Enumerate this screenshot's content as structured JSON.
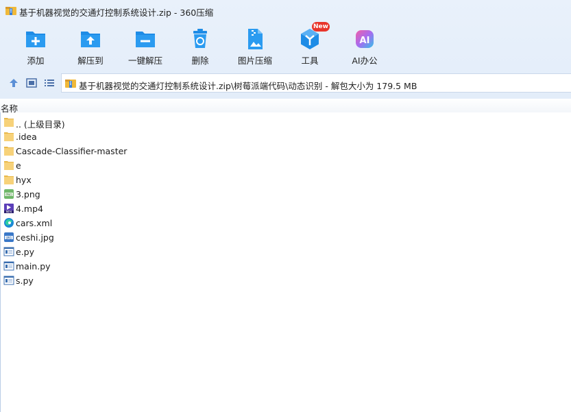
{
  "window": {
    "title": "基于机器视觉的交通灯控制系统设计.zip - 360压缩"
  },
  "toolbar": {
    "buttons": [
      {
        "label": "添加",
        "icon": "add-icon"
      },
      {
        "label": "解压到",
        "icon": "extract-to-icon"
      },
      {
        "label": "一键解压",
        "icon": "one-click-extract-icon"
      },
      {
        "label": "删除",
        "icon": "trash-icon"
      },
      {
        "label": "图片压缩",
        "icon": "image-compress-icon"
      },
      {
        "label": "工具",
        "icon": "tools-icon",
        "badge": "New"
      },
      {
        "label": "AI办公",
        "icon": "ai-office-icon"
      }
    ]
  },
  "navbar": {
    "path": "基于机器视觉的交通灯控制系统设计.zip\\树莓派端代码\\动态识别 - 解包大小为 179.5 MB"
  },
  "filelist": {
    "column_name": "名称",
    "items": [
      {
        "name": ".. (上级目录)",
        "type": "folder"
      },
      {
        "name": ".idea",
        "type": "folder"
      },
      {
        "name": "Cascade-Classifier-master",
        "type": "folder"
      },
      {
        "name": "e",
        "type": "folder"
      },
      {
        "name": "hyx",
        "type": "folder"
      },
      {
        "name": "3.png",
        "type": "png"
      },
      {
        "name": "4.mp4",
        "type": "mp4"
      },
      {
        "name": "cars.xml",
        "type": "xml"
      },
      {
        "name": "ceshi.jpg",
        "type": "jpg"
      },
      {
        "name": "e.py",
        "type": "py"
      },
      {
        "name": "main.py",
        "type": "py"
      },
      {
        "name": "s.py",
        "type": "py"
      }
    ]
  },
  "colors": {
    "accent": "#1e8ce6",
    "header_bg": "#e6eff9",
    "folder": "#f7d27a",
    "new_badge": "#e8352b"
  }
}
